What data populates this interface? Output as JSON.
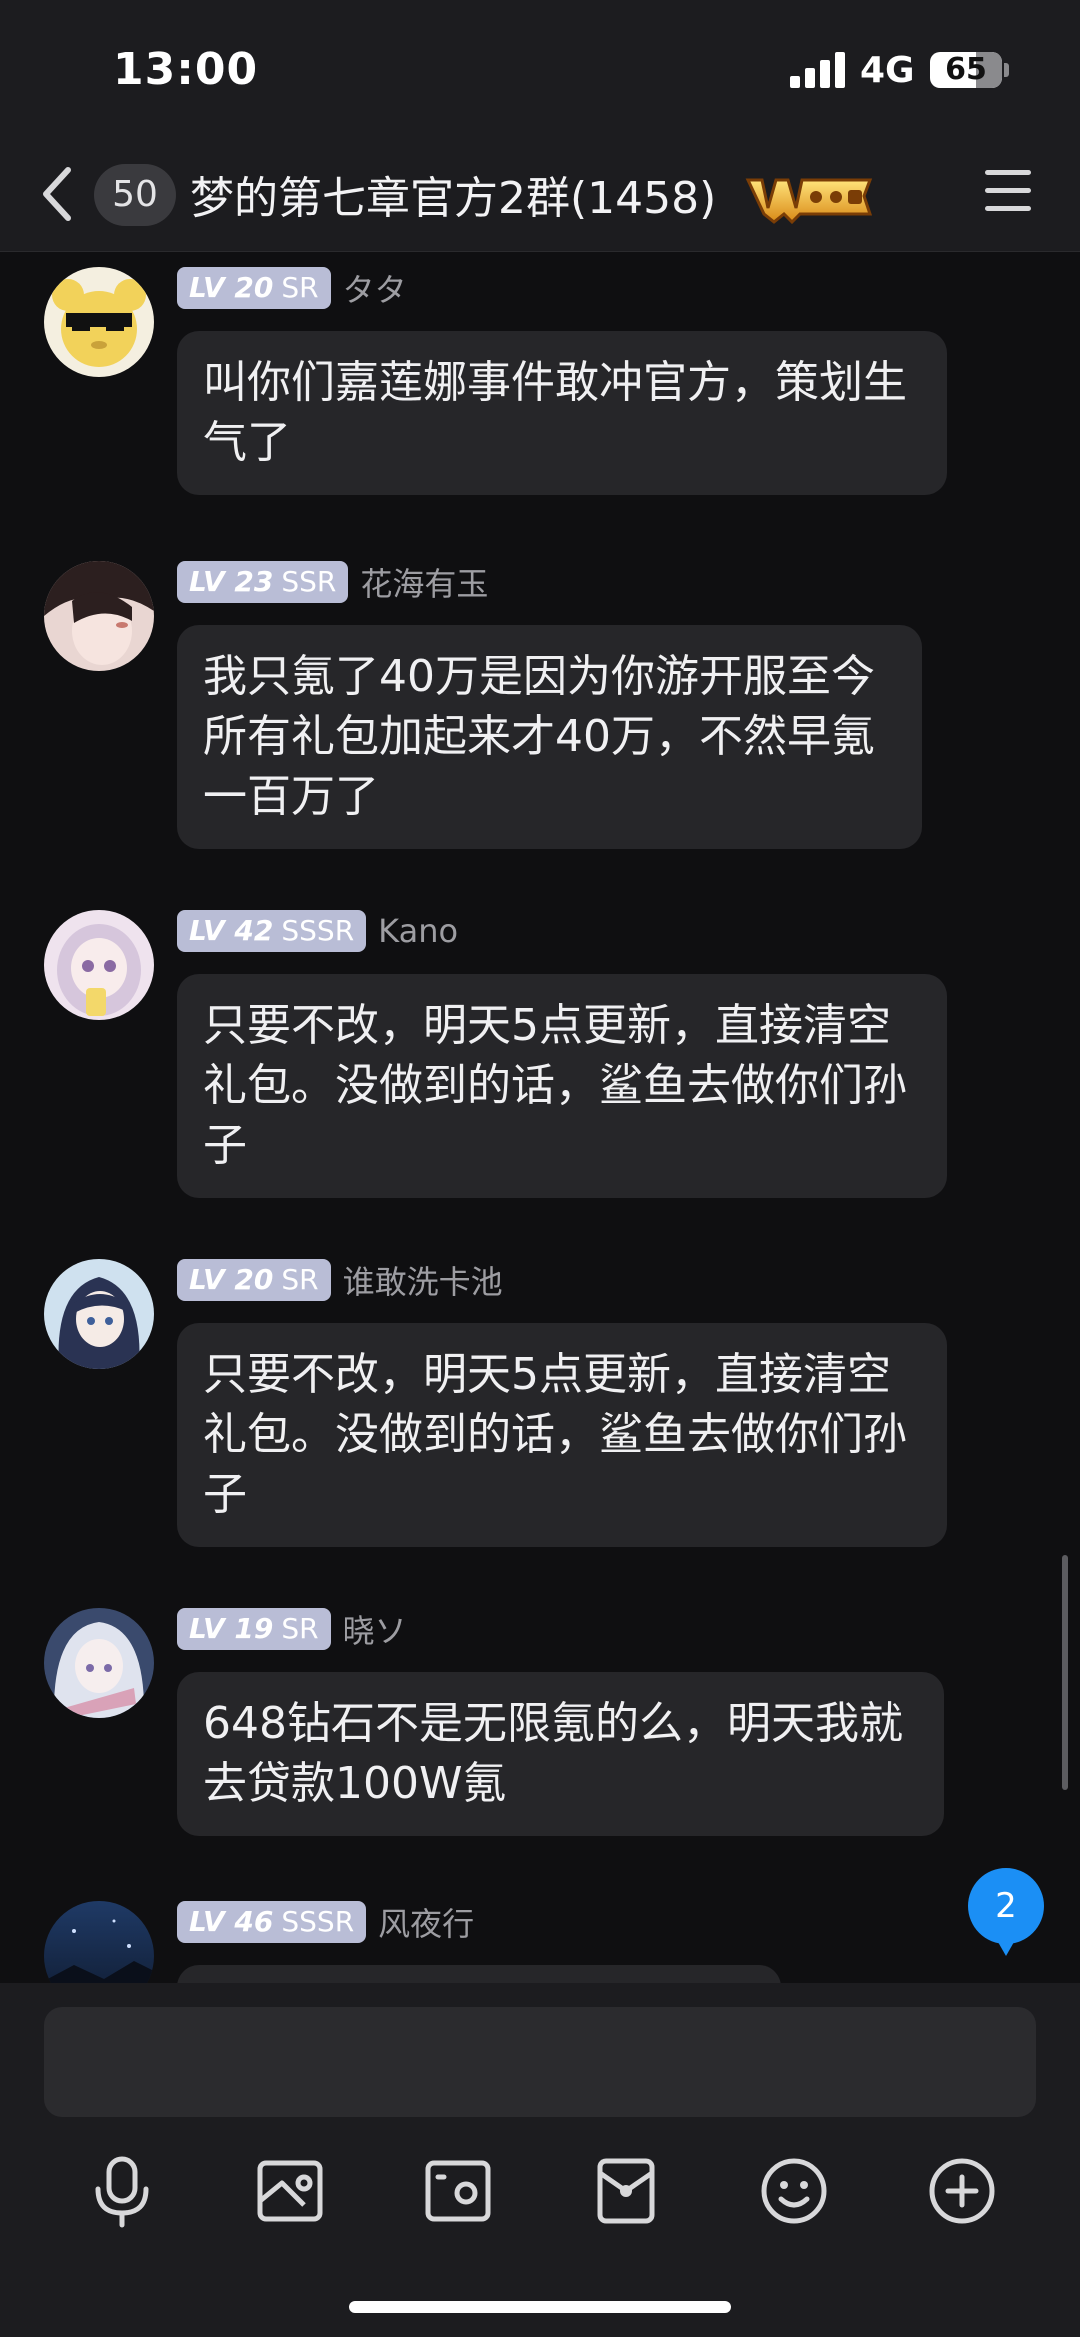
{
  "status_bar": {
    "time": "13:00",
    "network": "4G",
    "battery": "65"
  },
  "nav": {
    "unread_count": "50",
    "title": "梦的第七章官方2群(1458)",
    "badge_icon": "warrior-badge-icon"
  },
  "messages": [
    {
      "level": "20",
      "rank": "SR",
      "name": "タタ",
      "text": "叫你们嘉莲娜事件敢冲官方，策划生气了"
    },
    {
      "level": "23",
      "rank": "SSR",
      "name": "花海有玉",
      "text": "我只氪了40万是因为你游开服至今所有礼包加起来才40万，不然早氪一百万了"
    },
    {
      "level": "42",
      "rank": "SSSR",
      "name": "Kano",
      "text": "只要不改，明天5点更新，直接清空礼包。没做到的话，鲨鱼去做你们孙子"
    },
    {
      "level": "20",
      "rank": "SR",
      "name": "谁敢洗卡池",
      "text": "只要不改，明天5点更新，直接清空礼包。没做到的话，鲨鱼去做你们孙子"
    },
    {
      "level": "19",
      "rank": "SR",
      "name": "晓ソ",
      "text": "648钻石不是无限氪的么，明天我就去贷款100W氪"
    },
    {
      "level": "46",
      "rank": "SSSR",
      "name": "风夜行",
      "text": ""
    }
  ],
  "new_message_badge": "2",
  "level_prefix": "LV",
  "colors": {
    "accent": "#1b8ff5",
    "bubble": "#262629",
    "level_badge": "#b9bdd6"
  },
  "toolbar_icons": [
    "microphone-icon",
    "image-icon",
    "camera-icon",
    "red-packet-icon",
    "emoji-icon",
    "plus-icon"
  ]
}
